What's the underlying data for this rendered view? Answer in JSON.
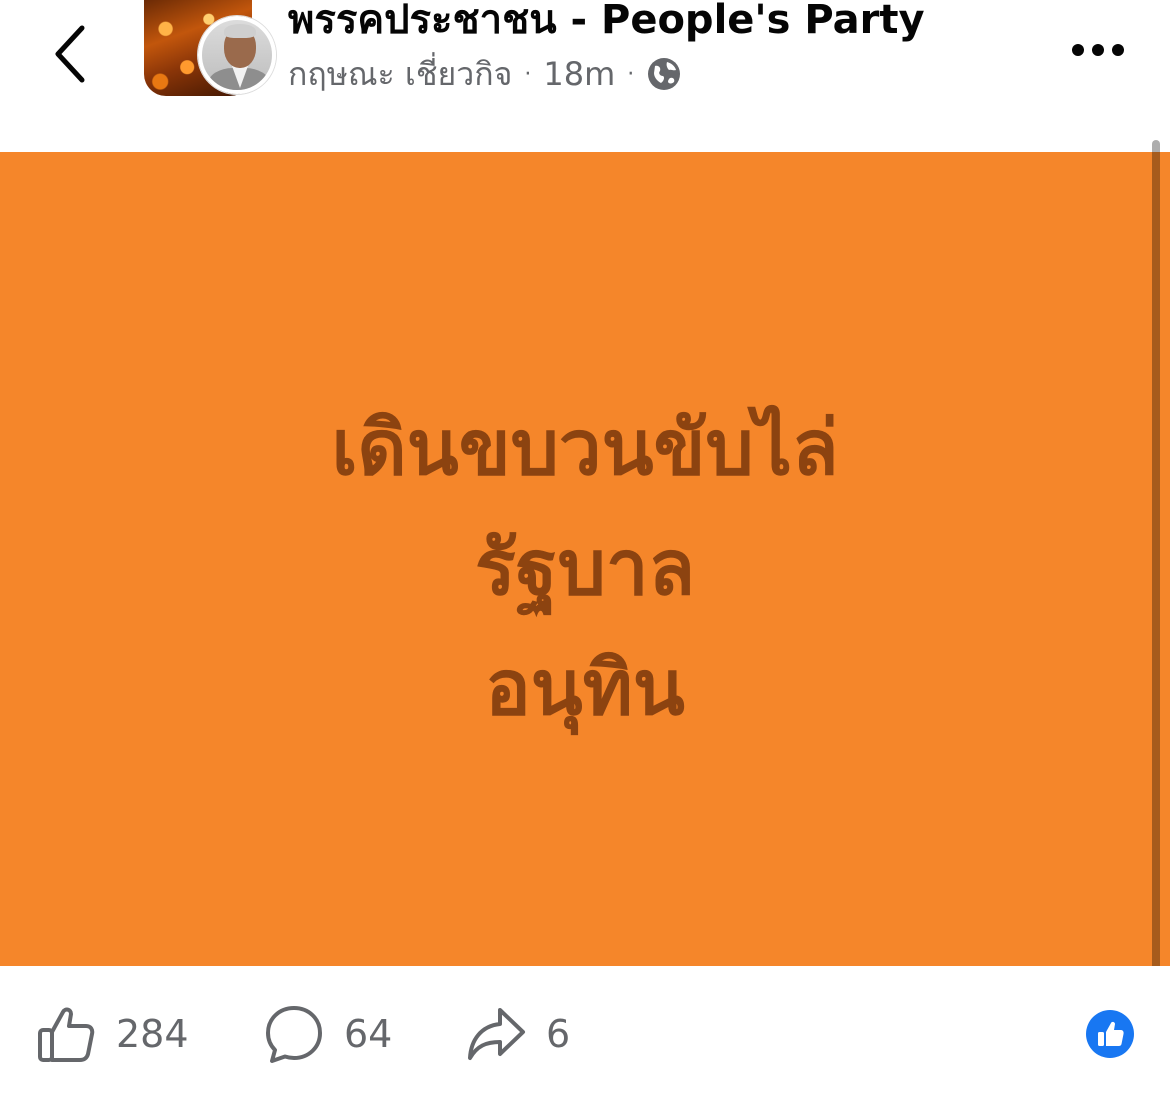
{
  "header": {
    "page_name": "พรรคประชาชน - People's Party",
    "author_name": "กฤษณะ เชี่ยวกิจ",
    "separator": "·",
    "timestamp": "18m",
    "audience_icon": "globe-icon",
    "back_icon": "chevron-left-icon",
    "more_icon": "more-horizontal-icon"
  },
  "post": {
    "background_color": "#f5862a",
    "text_color": "#8c4310",
    "lines": [
      "เดินขบวนขับไล่",
      "รัฐบาล",
      "อนุทิน"
    ]
  },
  "actions": {
    "likes": "284",
    "comments": "64",
    "shares": "6",
    "like_icon": "thumbs-up-icon",
    "comment_icon": "comment-bubble-icon",
    "share_icon": "share-arrow-icon",
    "reaction_icon": "like-reaction-icon",
    "reaction_color": "#1877f2"
  }
}
